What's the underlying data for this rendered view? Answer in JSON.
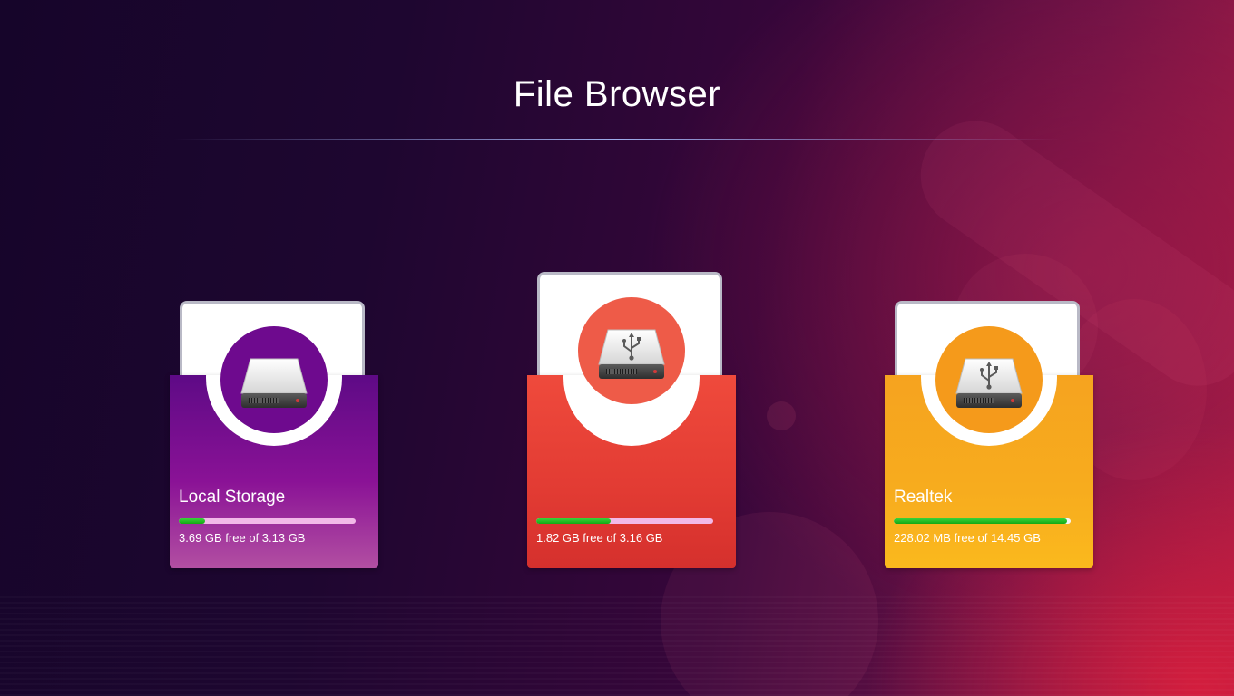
{
  "page": {
    "title": "File Browser"
  },
  "theme": {
    "accent_purple": "#7a0f92",
    "accent_red": "#e63d35",
    "accent_orange": "#f7a81f",
    "progress_used": "#22c022",
    "progress_track": "#f2b9e8"
  },
  "storages": [
    {
      "name": "Local Storage",
      "info": "3.69 GB free of 3.13 GB",
      "usage_fraction": 0.15,
      "icon": "hard-drive-icon",
      "color": "#7a0f92"
    },
    {
      "name": "",
      "info": "1.82 GB free of 3.16 GB",
      "usage_fraction": 0.42,
      "icon": "usb-drive-icon",
      "color": "#e63d35"
    },
    {
      "name": "Realtek",
      "info": "228.02 MB free of 14.45 GB",
      "usage_fraction": 0.98,
      "icon": "usb-drive-icon",
      "color": "#f7a81f"
    }
  ]
}
